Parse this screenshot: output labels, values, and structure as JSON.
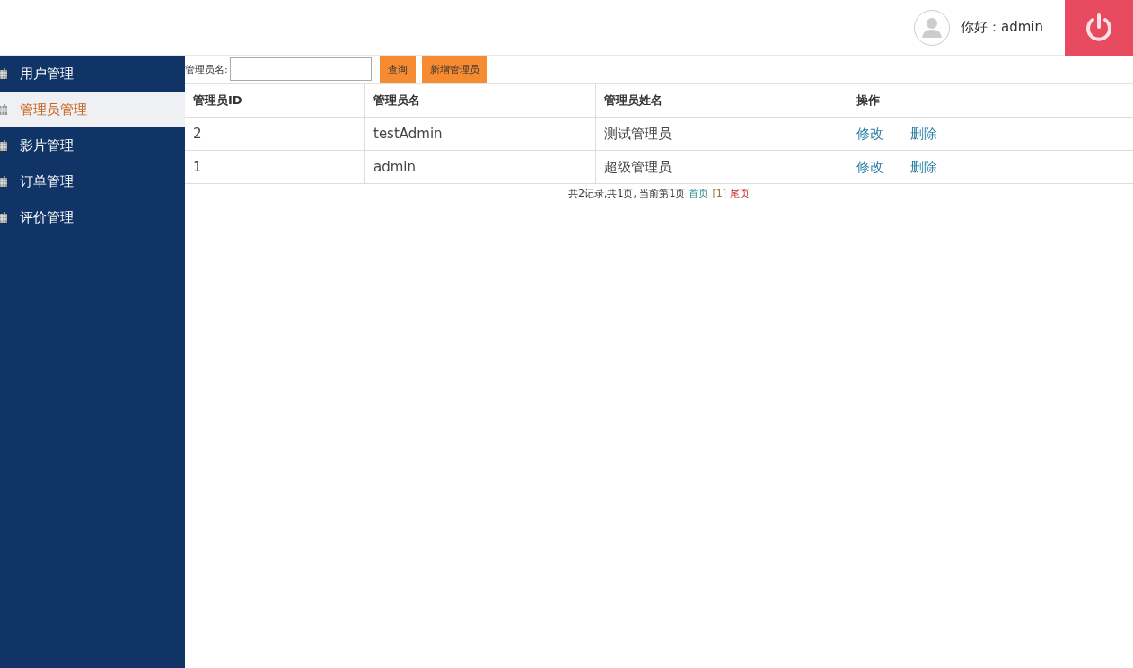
{
  "header": {
    "greeting": "你好：admin"
  },
  "sidebar": {
    "items": [
      {
        "label": "用户管理",
        "selected": false
      },
      {
        "label": "管理员管理",
        "selected": true
      },
      {
        "label": "影片管理",
        "selected": false
      },
      {
        "label": "订单管理",
        "selected": false
      },
      {
        "label": "评价管理",
        "selected": false
      }
    ]
  },
  "search": {
    "label": "管理员名:",
    "buttons": [
      "查询",
      "新增管理员"
    ]
  },
  "table": {
    "columns": [
      "管理员ID",
      "管理员名",
      "管理员姓名",
      "操作"
    ],
    "rows": [
      {
        "cells": [
          "2",
          "testAdmin",
          "测试管理员"
        ],
        "actions": [
          "修改",
          "删除"
        ]
      },
      {
        "cells": [
          "1",
          "admin",
          "超级管理员"
        ],
        "actions": [
          "修改",
          "删除"
        ]
      }
    ]
  },
  "pagination": {
    "summary": "共2记录,共1页, 当前第1页",
    "first": "首页",
    "pages": "[1]",
    "last": "尾页"
  }
}
